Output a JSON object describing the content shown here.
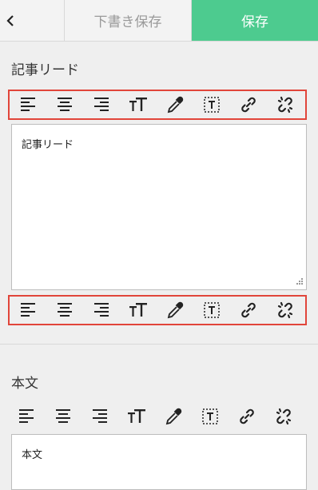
{
  "header": {
    "back_icon": "chevron-left-icon",
    "draft_label": "下書き保存",
    "save_label": "保存",
    "accent_color": "#4dcb8f"
  },
  "lead_section": {
    "title": "記事リード",
    "textarea_value": "記事リード"
  },
  "body_section": {
    "title": "本文",
    "textarea_value": "本文"
  },
  "toolbar_tools": [
    "align-left-icon",
    "align-center-icon",
    "align-right-icon",
    "text-size-icon",
    "eyedropper-icon",
    "text-box-icon",
    "link-icon",
    "unlink-icon"
  ],
  "highlight_color": "#e1453a"
}
